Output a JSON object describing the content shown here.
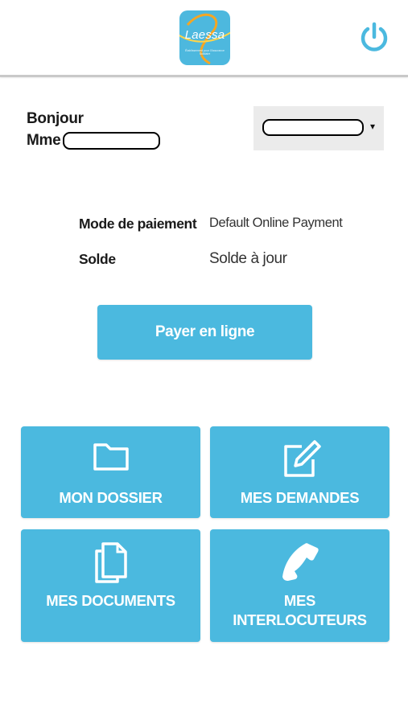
{
  "header": {
    "logo": {
      "name": "Laessa",
      "tagline": "Établissement pour l'Assurance Solidaire",
      "icon": "laessa-logo"
    },
    "power_icon": "power-icon",
    "accent": "#4bb9df"
  },
  "greeting": {
    "line1": "Bonjour",
    "line2_prefix": "Mme"
  },
  "account_select": {
    "selected": "",
    "caret": "▾"
  },
  "payment": {
    "mode_label": "Mode de paiement",
    "mode_value": "Default Online Payment",
    "balance_label": "Solde",
    "balance_value": "Solde à jour"
  },
  "pay_button": {
    "label": "Payer en ligne"
  },
  "tiles": [
    {
      "label": "MON DOSSIER",
      "icon": "folder-icon"
    },
    {
      "label": "MES DEMANDES",
      "icon": "edit-icon"
    },
    {
      "label": "MES DOCUMENTS",
      "icon": "documents-icon"
    },
    {
      "label_line1": "MES",
      "label_line2": "INTERLOCUTEURS",
      "icon": "phone-icon"
    }
  ]
}
